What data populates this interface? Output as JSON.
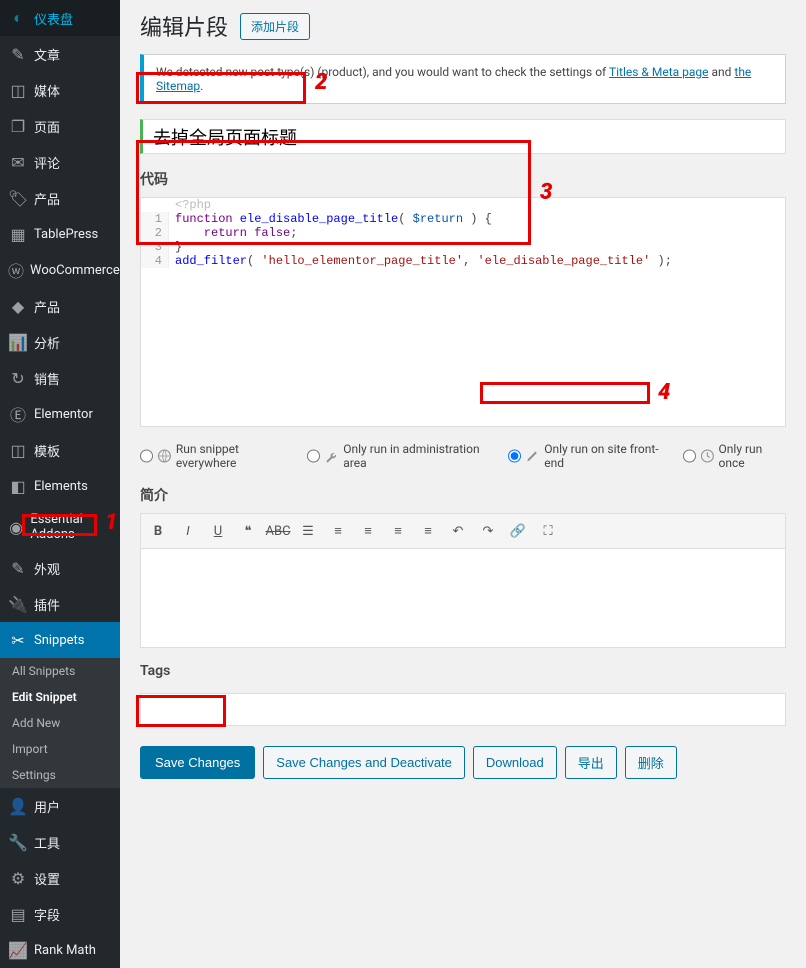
{
  "sidebar": {
    "items": [
      {
        "label": "仪表盘",
        "icon": "◐"
      },
      {
        "label": "文章",
        "icon": "✎"
      },
      {
        "label": "媒体",
        "icon": "◫"
      },
      {
        "label": "页面",
        "icon": "❐"
      },
      {
        "label": "评论",
        "icon": "✉"
      },
      {
        "label": "产品",
        "icon": "🏷"
      },
      {
        "label": "TablePress",
        "icon": "▦"
      },
      {
        "label": "WooCommerce",
        "icon": "ⓦ"
      },
      {
        "label": "产品",
        "icon": "◆"
      },
      {
        "label": "分析",
        "icon": "📊"
      },
      {
        "label": "销售",
        "icon": "↻"
      },
      {
        "label": "Elementor",
        "icon": "Ⓔ"
      },
      {
        "label": "模板",
        "icon": "◫"
      },
      {
        "label": "Elements",
        "icon": "◧"
      },
      {
        "label": "Essential Addons",
        "icon": "◉"
      },
      {
        "label": "外观",
        "icon": "✎"
      },
      {
        "label": "插件",
        "icon": "🔌"
      },
      {
        "label": "Snippets",
        "icon": "✂"
      },
      {
        "label": "用户",
        "icon": "👤"
      },
      {
        "label": "工具",
        "icon": "🔧"
      },
      {
        "label": "设置",
        "icon": "⚙"
      },
      {
        "label": "字段",
        "icon": "▤"
      },
      {
        "label": "Rank Math",
        "icon": "📈"
      }
    ],
    "submenu": [
      {
        "label": "All Snippets"
      },
      {
        "label": "Edit Snippet"
      },
      {
        "label": "Add New"
      },
      {
        "label": "Import"
      },
      {
        "label": "Settings"
      }
    ]
  },
  "header": {
    "title": "编辑片段",
    "add_btn": "添加片段"
  },
  "notice": {
    "prefix": "We detected new post type(s) (product), and you would want to check the settings of ",
    "link1": "Titles & Meta page",
    "mid": " and ",
    "link2": "the Sitemap",
    "suffix": "."
  },
  "snippet": {
    "title": "去掉全局页面标题"
  },
  "code": {
    "label": "代码",
    "placeholder": "<?php",
    "lines": {
      "1": {
        "n": "1",
        "text_a": "function",
        "text_b": " ele_disable_page_title",
        "text_c": "( ",
        "text_d": "$return",
        "text_e": " ) {"
      },
      "2": {
        "n": "2",
        "text_a": "    return",
        "text_b": " false",
        "text_c": ";"
      },
      "3": {
        "n": "3",
        "text": "}"
      },
      "4": {
        "n": "4",
        "text_a": "add_filter",
        "text_b": "( ",
        "text_c": "'hello_elementor_page_title'",
        "text_d": ", ",
        "text_e": "'ele_disable_page_title'",
        "text_f": " );"
      }
    }
  },
  "scope": {
    "opt1": "Run snippet everywhere",
    "opt2": "Only run in administration area",
    "opt3": "Only run on site front-end",
    "opt4": "Only run once"
  },
  "desc": {
    "label": "简介"
  },
  "tags": {
    "label": "Tags"
  },
  "actions": {
    "save": "Save Changes",
    "save_deact": "Save Changes and Deactivate",
    "download": "Download",
    "export": "导出",
    "delete": "删除"
  },
  "annotations": {
    "n1": "1",
    "n2": "2",
    "n3": "3",
    "n4": "4"
  }
}
